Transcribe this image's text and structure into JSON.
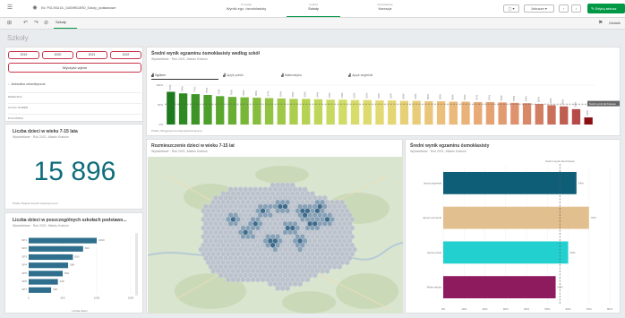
{
  "topbar": {
    "app_name": "Ed. POLSKA DL_DASHBOARD_Szkoly_podstawowe",
    "nav": [
      {
        "top": "Przegląd",
        "bottom": "Wyniki egz. ósmoklasisty",
        "active": false
      },
      {
        "top": "Analiza",
        "bottom": "Szkoły",
        "active": true
      },
      {
        "top": "Opowiadanie",
        "bottom": "Narracje",
        "active": false
      }
    ],
    "sheets_label": "Arkusze",
    "edit_label": "Edytuj arkusz",
    "bookmark_label": "Zakładki"
  },
  "toolbar": {
    "selection_tab": "Szkoły"
  },
  "sheet_title": "Szkoły",
  "filters": {
    "years": [
      "2019",
      "2020",
      "2021",
      "2022"
    ],
    "clear_label": "Wyczyść wybór",
    "items": [
      "Jednostka urbanistyczna",
      "DZIELNICA",
      "ULICA I NUMER",
      "PLACÓWKA"
    ]
  },
  "kpi": {
    "title": "Liczba dzieci w wieku 7-15 lata",
    "subtitle": "Wyświetlane · Rok 2021, Miasto Kraków",
    "value": "15 896",
    "footnote": "Źródło: Rejestr danych statystycznych"
  },
  "small_bar": {
    "title": "Liczba dzieci w poszczególnych szkołach podstawo...",
    "subtitle": "Wyświetlane · Rok 2021, Miasto Kraków",
    "footer": "Liczba dzieci"
  },
  "top_chart": {
    "title": "Średni wynik egzaminu ósmoklasisty według szkół",
    "subtitle": "Wyświetlane · Rok 2021, Miasto Kraków",
    "tabs": [
      "Ogółem",
      "Język polski",
      "Matematyka",
      "Język angielski"
    ],
    "ref_label": "Średni wynik dla Krakowa",
    "footnote": "Źródło: Okręgowa Komisja Egzaminacyjna"
  },
  "map": {
    "title": "Rozmieszczenie dzieci w wieku 7-15 lat",
    "subtitle": "Wyświetlane · Rok 2021, Miasto Kraków"
  },
  "hbar": {
    "title": "Średni wynik egzaminu ósmoklasisty",
    "subtitle": "Wyświetlane · Rok 2021, Miasto Kraków",
    "ref_label": "Średni wynik dla Kraków"
  },
  "chart_data": [
    {
      "type": "bar",
      "id": "top",
      "values": [
        83,
        79,
        77,
        75,
        72,
        70,
        69,
        68,
        67,
        66,
        65,
        65,
        64,
        63,
        63,
        62,
        62,
        61,
        61,
        60,
        60,
        59,
        59,
        58,
        58,
        57,
        57,
        56,
        55,
        54,
        52,
        49,
        46,
        39,
        18
      ],
      "colors": [
        "#1e7a1e",
        "#2f8a22",
        "#3d9426",
        "#4c9f2a",
        "#5aa72e",
        "#69ae33",
        "#78b638",
        "#86bd3d",
        "#93c343",
        "#a0c848",
        "#acce4e",
        "#b6d254",
        "#bfd65a",
        "#c8d960",
        "#d1dc66",
        "#d8dc6a",
        "#dedb6e",
        "#e2d972",
        "#e5d675",
        "#e7d178",
        "#e9cc7a",
        "#eac67b",
        "#ebc07b",
        "#ebb97a",
        "#eab279",
        "#e8ab77",
        "#e5a374",
        "#e29b71",
        "#de926d",
        "#d98968",
        "#d27e62",
        "#c96f5a",
        "#bf5f52",
        "#b54a49",
        "#8b0f10"
      ],
      "yticks": [
        "0%",
        "50%",
        "100%"
      ],
      "ylim": [
        0,
        100
      ],
      "ref": 52
    },
    {
      "type": "bar",
      "id": "small",
      "categories": [
        "SP1",
        "SP2",
        "SP3",
        "SP4",
        "SP5",
        "SP6",
        "SP7"
      ],
      "values": [
        1000,
        800,
        650,
        580,
        500,
        430,
        330
      ],
      "xticks": [
        "0",
        "500",
        "1000",
        "1500"
      ],
      "xlim": [
        0,
        1500
      ]
    },
    {
      "type": "bar",
      "id": "hbar",
      "categories": [
        "Język angielski",
        "Język niemiecki",
        "Język polski",
        "Matematyka"
      ],
      "values": [
        64,
        70,
        60,
        54
      ],
      "colors": [
        "#0f5e78",
        "#e2bf8f",
        "#23d0d0",
        "#8e1b5e"
      ],
      "xticks": [
        "0%",
        "10%",
        "20%",
        "30%",
        "40%",
        "50%",
        "60%",
        "70%",
        "80%"
      ],
      "xlim": [
        0,
        80
      ],
      "ref": 56
    }
  ]
}
